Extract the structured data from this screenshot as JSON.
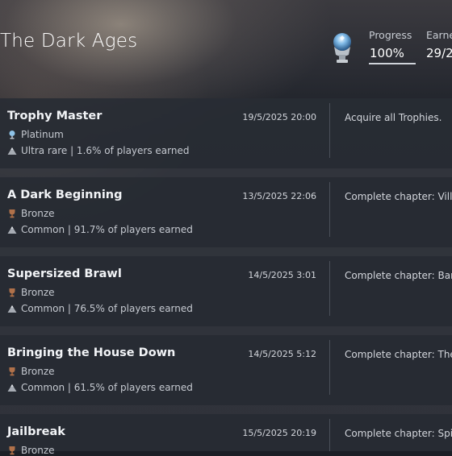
{
  "game": {
    "title": "The Dark Ages"
  },
  "stats": {
    "progress_label": "Progress",
    "progress_value": "100%",
    "earned_label": "Earne",
    "earned_value": "29/2"
  },
  "trophies": [
    {
      "name": "Trophy Master",
      "grade": "Platinum",
      "grade_icon": "platinum-trophy-icon",
      "rarity": "Ultra rare | 1.6% of players earned",
      "date": "19/5/2025  20:00",
      "description": "Acquire all Trophies."
    },
    {
      "name": "A Dark Beginning",
      "grade": "Bronze",
      "grade_icon": "bronze-trophy-icon",
      "rarity": "Common | 91.7% of players earned",
      "date": "13/5/2025  22:06",
      "description": "Complete chapter: Villag"
    },
    {
      "name": "Supersized Brawl",
      "grade": "Bronze",
      "grade_icon": "bronze-trophy-icon",
      "rarity": "Common | 76.5% of players earned",
      "date": "14/5/2025  3:01",
      "description": "Complete chapter: Barri"
    },
    {
      "name": "Bringing the House Down",
      "grade": "Bronze",
      "grade_icon": "bronze-trophy-icon",
      "rarity": "Common | 61.5% of players earned",
      "date": "14/5/2025  5:12",
      "description": "Complete chapter: The "
    },
    {
      "name": "Jailbreak",
      "grade": "Bronze",
      "grade_icon": "bronze-trophy-icon",
      "rarity": "",
      "date": "15/5/2025  20:19",
      "description": "Complete chapter: Spire"
    }
  ],
  "colors": {
    "platinum": "#8fc3e8",
    "bronze": "#b0714a",
    "row_bg": "#282c34",
    "text": "#e6e8ec"
  }
}
